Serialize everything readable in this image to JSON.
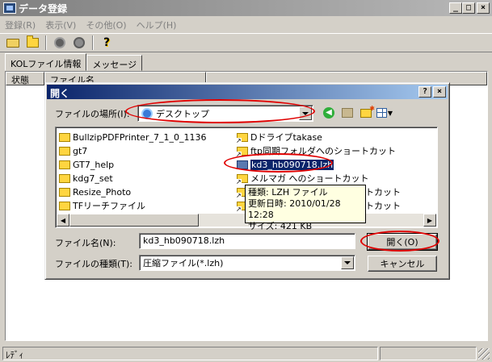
{
  "window": {
    "title": "データ登録"
  },
  "menu": [
    "登録(R)",
    "表示(V)",
    "その他(O)",
    "ヘルプ(H)"
  ],
  "tabs": [
    "KOLファイル情報",
    "メッセージ"
  ],
  "columns": [
    "状態",
    "ファイル名"
  ],
  "status": {
    "text": "ﾚﾃﾞｨ"
  },
  "dialog": {
    "title": "開く",
    "location_label": "ファイルの場所(I):",
    "location_value": "デスクトップ",
    "files_left": [
      "BullzipPDFPrinter_7_1_0_1136",
      "gt7",
      "GT7_help",
      "kdg7_set",
      "Resize_Photo",
      "TFリーチファイル"
    ],
    "files_right": [
      "Dドライブtakase",
      "ftp同期フォルダへのショートカット",
      "kd3_hb090718.lzh",
      "メルマガ へのショートカット",
      "ョートカット",
      "ョートカット"
    ],
    "tooltip": {
      "line1": "種類: LZH ファイル",
      "line2": "更新日時: 2010/01/28 12:28",
      "line3": "サイズ: 421 KB"
    },
    "filename_label": "ファイル名(N):",
    "filename_value": "kd3_hb090718.lzh",
    "filetype_label": "ファイルの種類(T):",
    "filetype_value": "圧縮ファイル(*.lzh)",
    "open_button": "開く(O)",
    "cancel_button": "キャンセル"
  },
  "colors": {
    "titlebar": "#0a246a",
    "annotation": "#e00000",
    "tooltip": "#ffffe1"
  }
}
